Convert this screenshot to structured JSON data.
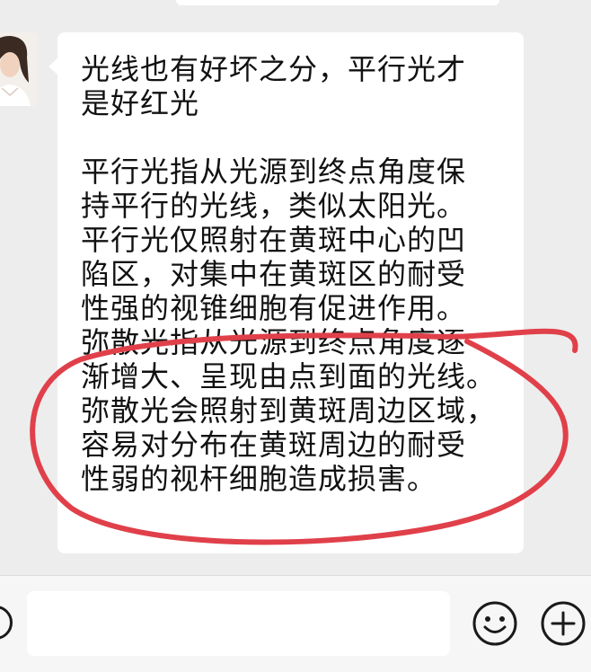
{
  "chat": {
    "message": {
      "lines": [
        "光线也有好坏之分，平行光才",
        "是好红光",
        "",
        "平行光指从光源到终点角度保",
        "持平行的光线，类似太阳光。",
        "平行光仅照射在黄斑中心的凹",
        "陷区，对集中在黄斑区的耐受",
        "性强的视锥细胞有促进作用。",
        "弥散光指从光源到终点角度逐",
        "渐增大、呈现由点到面的光线。",
        "弥散光会照射到黄斑周边区域，",
        "容易对分布在黄斑周边的耐受",
        "性弱的视杆细胞造成损害。"
      ]
    }
  },
  "annotation": {
    "color": "#e0404a",
    "shape": "hand-drawn-ellipse"
  },
  "input_bar": {
    "voice_icon": "voice-icon",
    "emoji_icon": "smiley-face-icon",
    "plus_icon": "plus-circle-icon",
    "input_value": ""
  }
}
